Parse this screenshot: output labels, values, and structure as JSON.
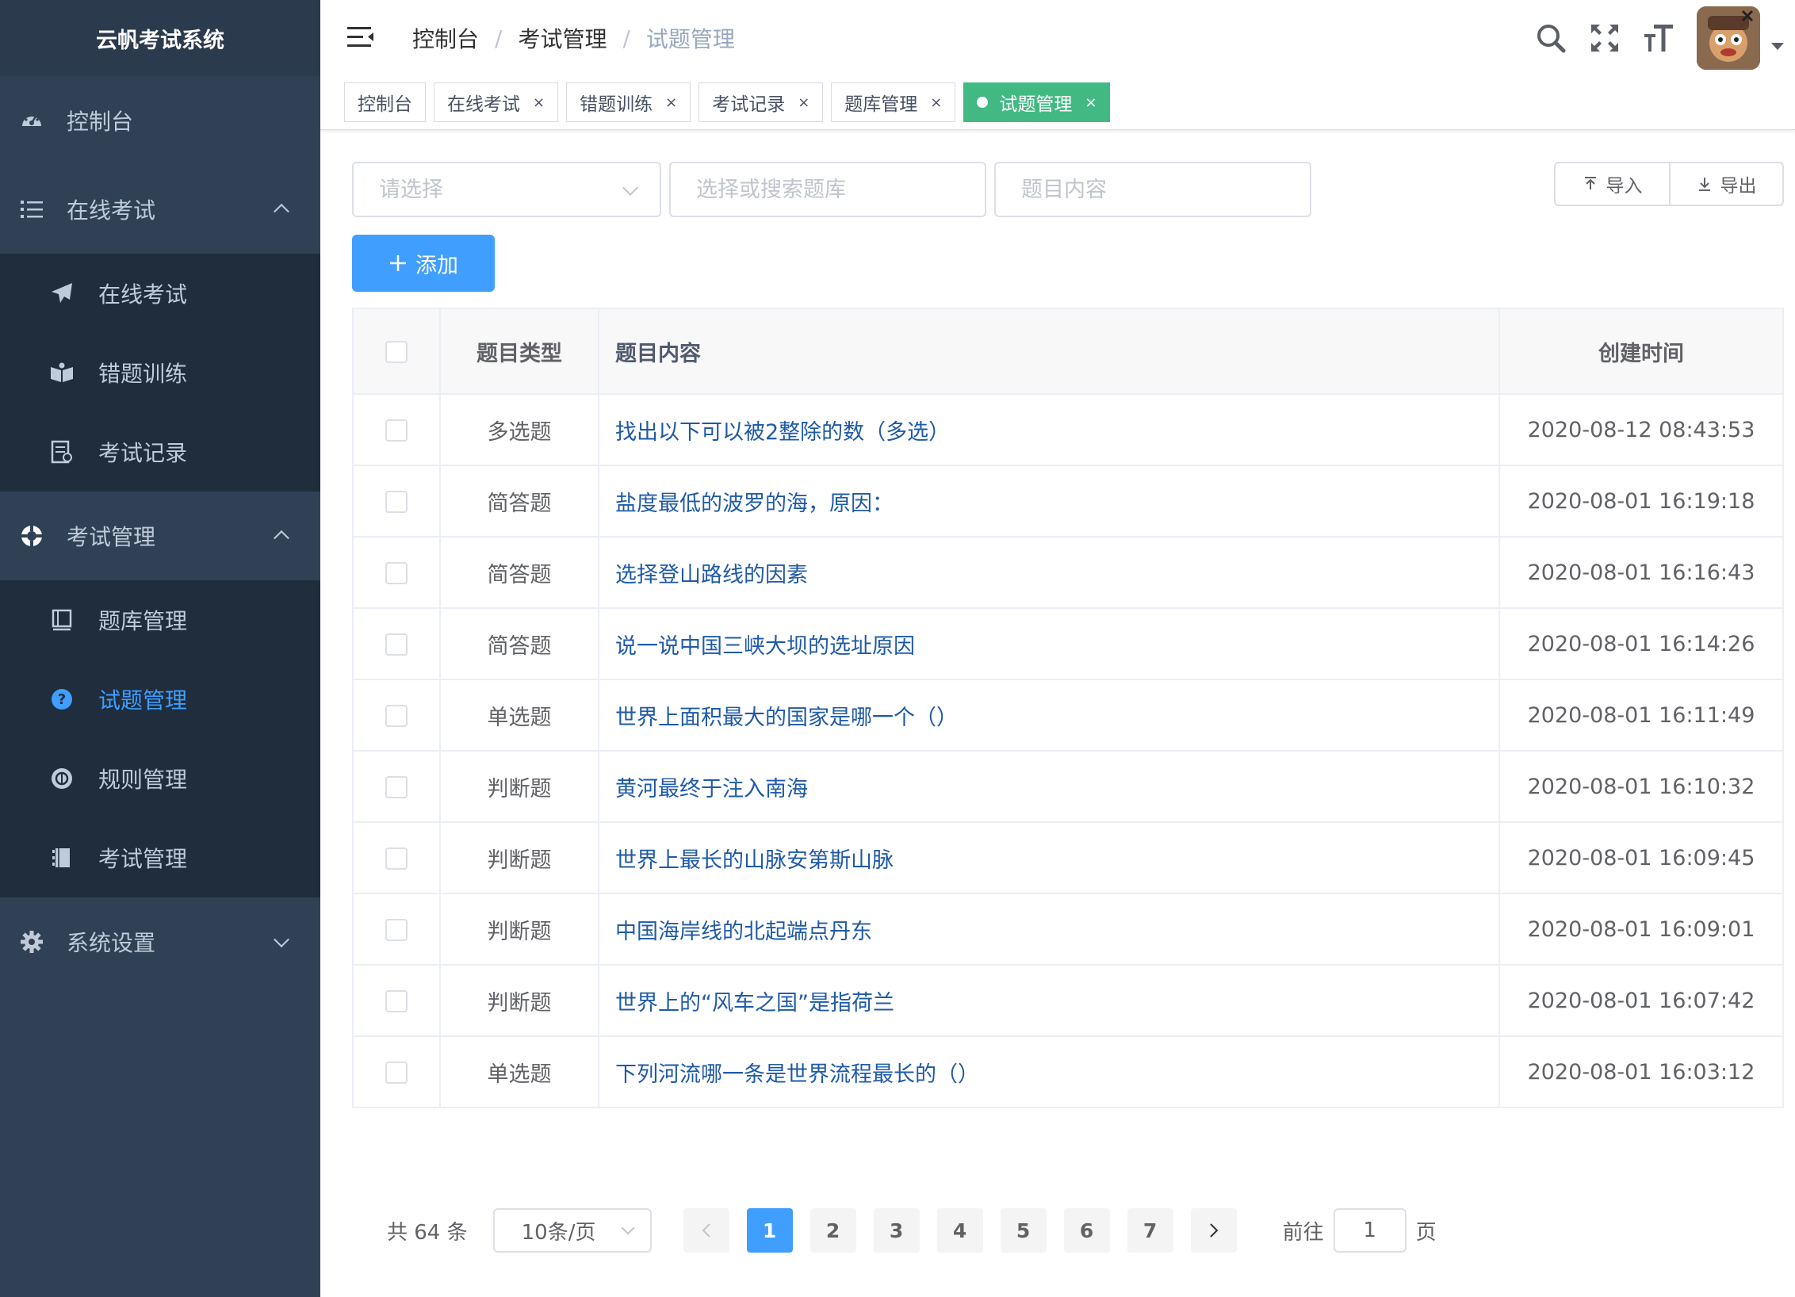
{
  "app": {
    "title": "云帆考试系统"
  },
  "sidebar": {
    "items": [
      {
        "label": "控制台",
        "icon": "dashboard-icon"
      },
      {
        "label": "在线考试",
        "icon": "list-icon",
        "children": [
          {
            "label": "在线考试",
            "icon": "paper-plane-icon"
          },
          {
            "label": "错题训练",
            "icon": "book-open-icon"
          },
          {
            "label": "考试记录",
            "icon": "document-icon"
          }
        ]
      },
      {
        "label": "考试管理",
        "icon": "lifebuoy-icon",
        "children": [
          {
            "label": "题库管理",
            "icon": "book-icon"
          },
          {
            "label": "试题管理",
            "icon": "question-circle-icon",
            "active": true
          },
          {
            "label": "规则管理",
            "icon": "rule-icon"
          },
          {
            "label": "考试管理",
            "icon": "notebook-icon"
          }
        ]
      },
      {
        "label": "系统设置",
        "icon": "gear-icon"
      }
    ]
  },
  "header": {
    "breadcrumb": [
      "控制台",
      "考试管理",
      "试题管理"
    ],
    "icons": [
      "search-icon",
      "fullscreen-icon",
      "font-size-icon"
    ]
  },
  "tags": [
    {
      "label": "控制台",
      "closable": false
    },
    {
      "label": "在线考试",
      "closable": true
    },
    {
      "label": "错题训练",
      "closable": true
    },
    {
      "label": "考试记录",
      "closable": true
    },
    {
      "label": "题库管理",
      "closable": true
    },
    {
      "label": "试题管理",
      "closable": true,
      "active": true
    }
  ],
  "filters": {
    "type_placeholder": "请选择",
    "repo_placeholder": "选择或搜索题库",
    "content_placeholder": "题目内容",
    "import_label": "导入",
    "export_label": "导出",
    "add_label": "添加"
  },
  "table": {
    "headers": {
      "type": "题目类型",
      "content": "题目内容",
      "time": "创建时间"
    },
    "rows": [
      {
        "type": "多选题",
        "content": "找出以下可以被2整除的数（多选）",
        "time": "2020-08-12 08:43:53"
      },
      {
        "type": "简答题",
        "content": "盐度最低的波罗的海，原因：",
        "time": "2020-08-01 16:19:18"
      },
      {
        "type": "简答题",
        "content": "选择登山路线的因素",
        "time": "2020-08-01 16:16:43"
      },
      {
        "type": "简答题",
        "content": "说一说中国三峡大坝的选址原因",
        "time": "2020-08-01 16:14:26"
      },
      {
        "type": "单选题",
        "content": "世界上面积最大的国家是哪一个（）",
        "time": "2020-08-01 16:11:49"
      },
      {
        "type": "判断题",
        "content": "黄河最终于注入南海",
        "time": "2020-08-01 16:10:32"
      },
      {
        "type": "判断题",
        "content": "世界上最长的山脉安第斯山脉",
        "time": "2020-08-01 16:09:45"
      },
      {
        "type": "判断题",
        "content": "中国海岸线的北起端点丹东",
        "time": "2020-08-01 16:09:01"
      },
      {
        "type": "判断题",
        "content": "世界上的“风车之国”是指荷兰",
        "time": "2020-08-01 16:07:42"
      },
      {
        "type": "单选题",
        "content": "下列河流哪一条是世界流程最长的（）",
        "time": "2020-08-01 16:03:12"
      }
    ]
  },
  "pagination": {
    "total_text": "共 64 条",
    "page_size": "10条/页",
    "pages": [
      "1",
      "2",
      "3",
      "4",
      "5",
      "6",
      "7"
    ],
    "current": "1",
    "goto_prefix": "前往",
    "goto_value": "1",
    "goto_suffix": "页"
  },
  "colors": {
    "sidebar_bg": "#304156",
    "active": "#409eff",
    "tag_active": "#42b983"
  }
}
